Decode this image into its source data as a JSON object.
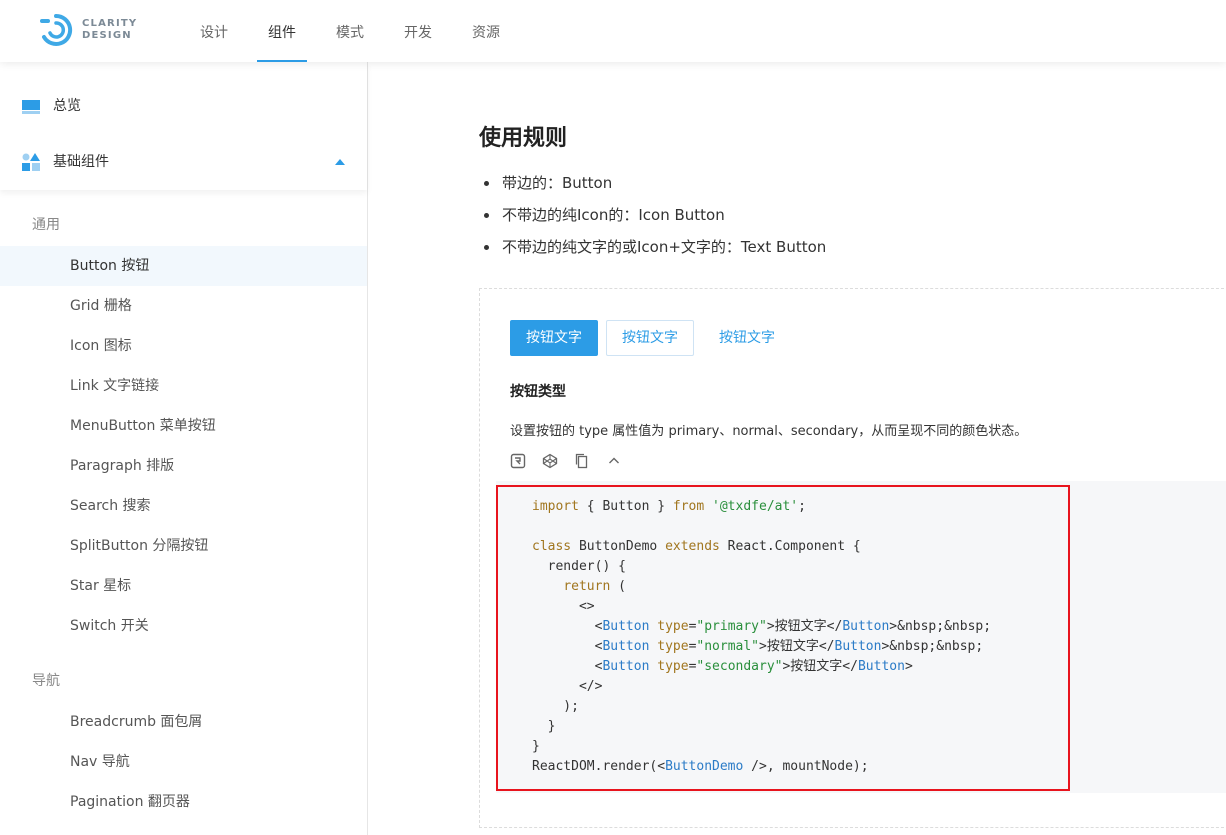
{
  "brand": {
    "line1": "CLARITY",
    "line2": "DESIGN",
    "accent": "#2c9ce6"
  },
  "topnav": [
    {
      "label": "设计",
      "active": false
    },
    {
      "label": "组件",
      "active": true
    },
    {
      "label": "模式",
      "active": false
    },
    {
      "label": "开发",
      "active": false
    },
    {
      "label": "资源",
      "active": false
    }
  ],
  "sidebar": {
    "overview": {
      "label": "总览",
      "icon": "overview-icon"
    },
    "basic": {
      "label": "基础组件",
      "icon": "components-icon",
      "expanded": true
    },
    "groups": [
      {
        "title": "通用",
        "items": [
          {
            "label": "Button 按钮",
            "active": true
          },
          {
            "label": "Grid 栅格"
          },
          {
            "label": "Icon 图标"
          },
          {
            "label": "Link 文字链接"
          },
          {
            "label": "MenuButton 菜单按钮"
          },
          {
            "label": "Paragraph 排版"
          },
          {
            "label": "Search 搜索"
          },
          {
            "label": "SplitButton 分隔按钮"
          },
          {
            "label": "Star 星标"
          },
          {
            "label": "Switch 开关"
          }
        ]
      },
      {
        "title": "导航",
        "items": [
          {
            "label": "Breadcrumb 面包屑"
          },
          {
            "label": "Nav 导航"
          },
          {
            "label": "Pagination 翻页器"
          }
        ]
      }
    ]
  },
  "main": {
    "heading": "使用规则",
    "rules": [
      "带边的：Button",
      "不带边的纯Icon的：Icon Button",
      "不带边的纯文字的或Icon+文字的：Text Button"
    ],
    "demo": {
      "buttons": {
        "primary": "按钮文字",
        "normal": "按钮文字",
        "secondary": "按钮文字"
      },
      "title": "按钮类型",
      "description": "设置按钮的 type 属性值为 primary、normal、secondary，从而呈现不同的颜色状态。",
      "tools": [
        "codesandbox-icon",
        "codepen-icon",
        "copy-icon",
        "collapse-icon"
      ],
      "code": {
        "l1_import": "import",
        "l1_names": " { Button } ",
        "l1_from": "from",
        "l1_str": "'@txdfe/at'",
        "l1_end": ";",
        "l3_class": "class",
        "l3_name": " ButtonDemo ",
        "l3_extends": "extends",
        "l3_rest": " React.Component {",
        "l4": "  render() {",
        "l5_return": "return",
        "l5_rest": " (",
        "l6": "      <>",
        "b1_open": "Button",
        "b1_attr": "type",
        "b1_val": "\"primary\"",
        "b1_text": ">按钮文字</",
        "b1_close": "Button",
        "b1_tail": ">&nbsp;&nbsp;",
        "b2_open": "Button",
        "b2_attr": "type",
        "b2_val": "\"normal\"",
        "b2_text": ">按钮文字</",
        "b2_close": "Button",
        "b2_tail": ">&nbsp;&nbsp;",
        "b3_open": "Button",
        "b3_attr": "type",
        "b3_val": "\"secondary\"",
        "b3_text": ">按钮文字</",
        "b3_close": "Button",
        "b3_tail": ">",
        "l10": "      </>",
        "l11": "    );",
        "l12": "  }",
        "l13": "}",
        "l14_pre": "ReactDOM.render(<",
        "l14_comp": "ButtonDemo",
        "l14_post": " />, mountNode);"
      }
    }
  },
  "colors": {
    "highlight": "#e8141e",
    "primary": "#2c9ce6",
    "active_row": "#f2f8fd"
  }
}
